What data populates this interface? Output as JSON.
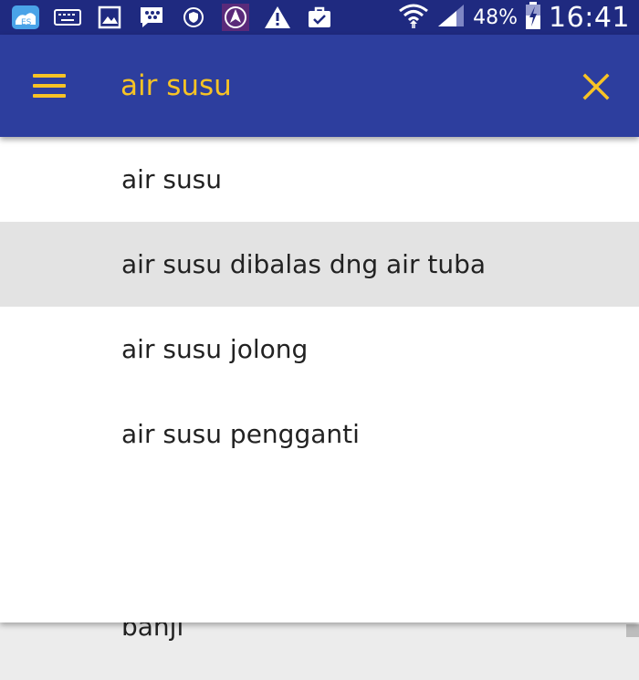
{
  "status_bar": {
    "icons": [
      "es-file-explorer-icon",
      "keyboard-icon",
      "image-icon",
      "bbm-icon",
      "shield-icon",
      "navigation-icon",
      "warning-icon",
      "briefcase-icon"
    ],
    "battery_percent": "48%",
    "time": "16:41"
  },
  "search": {
    "query": "air susu"
  },
  "suggestions": [
    {
      "label": "air susu"
    },
    {
      "label": "air susu dibalas dng air tuba"
    },
    {
      "label": "air susu jolong"
    },
    {
      "label": "air susu pengganti"
    }
  ],
  "background_list": {
    "partial_item": "banji"
  },
  "colors": {
    "status_bar": "#1f2a80",
    "app_bar": "#2d3e9e",
    "accent": "#f7c325",
    "highlight": "#e3e3e3"
  }
}
